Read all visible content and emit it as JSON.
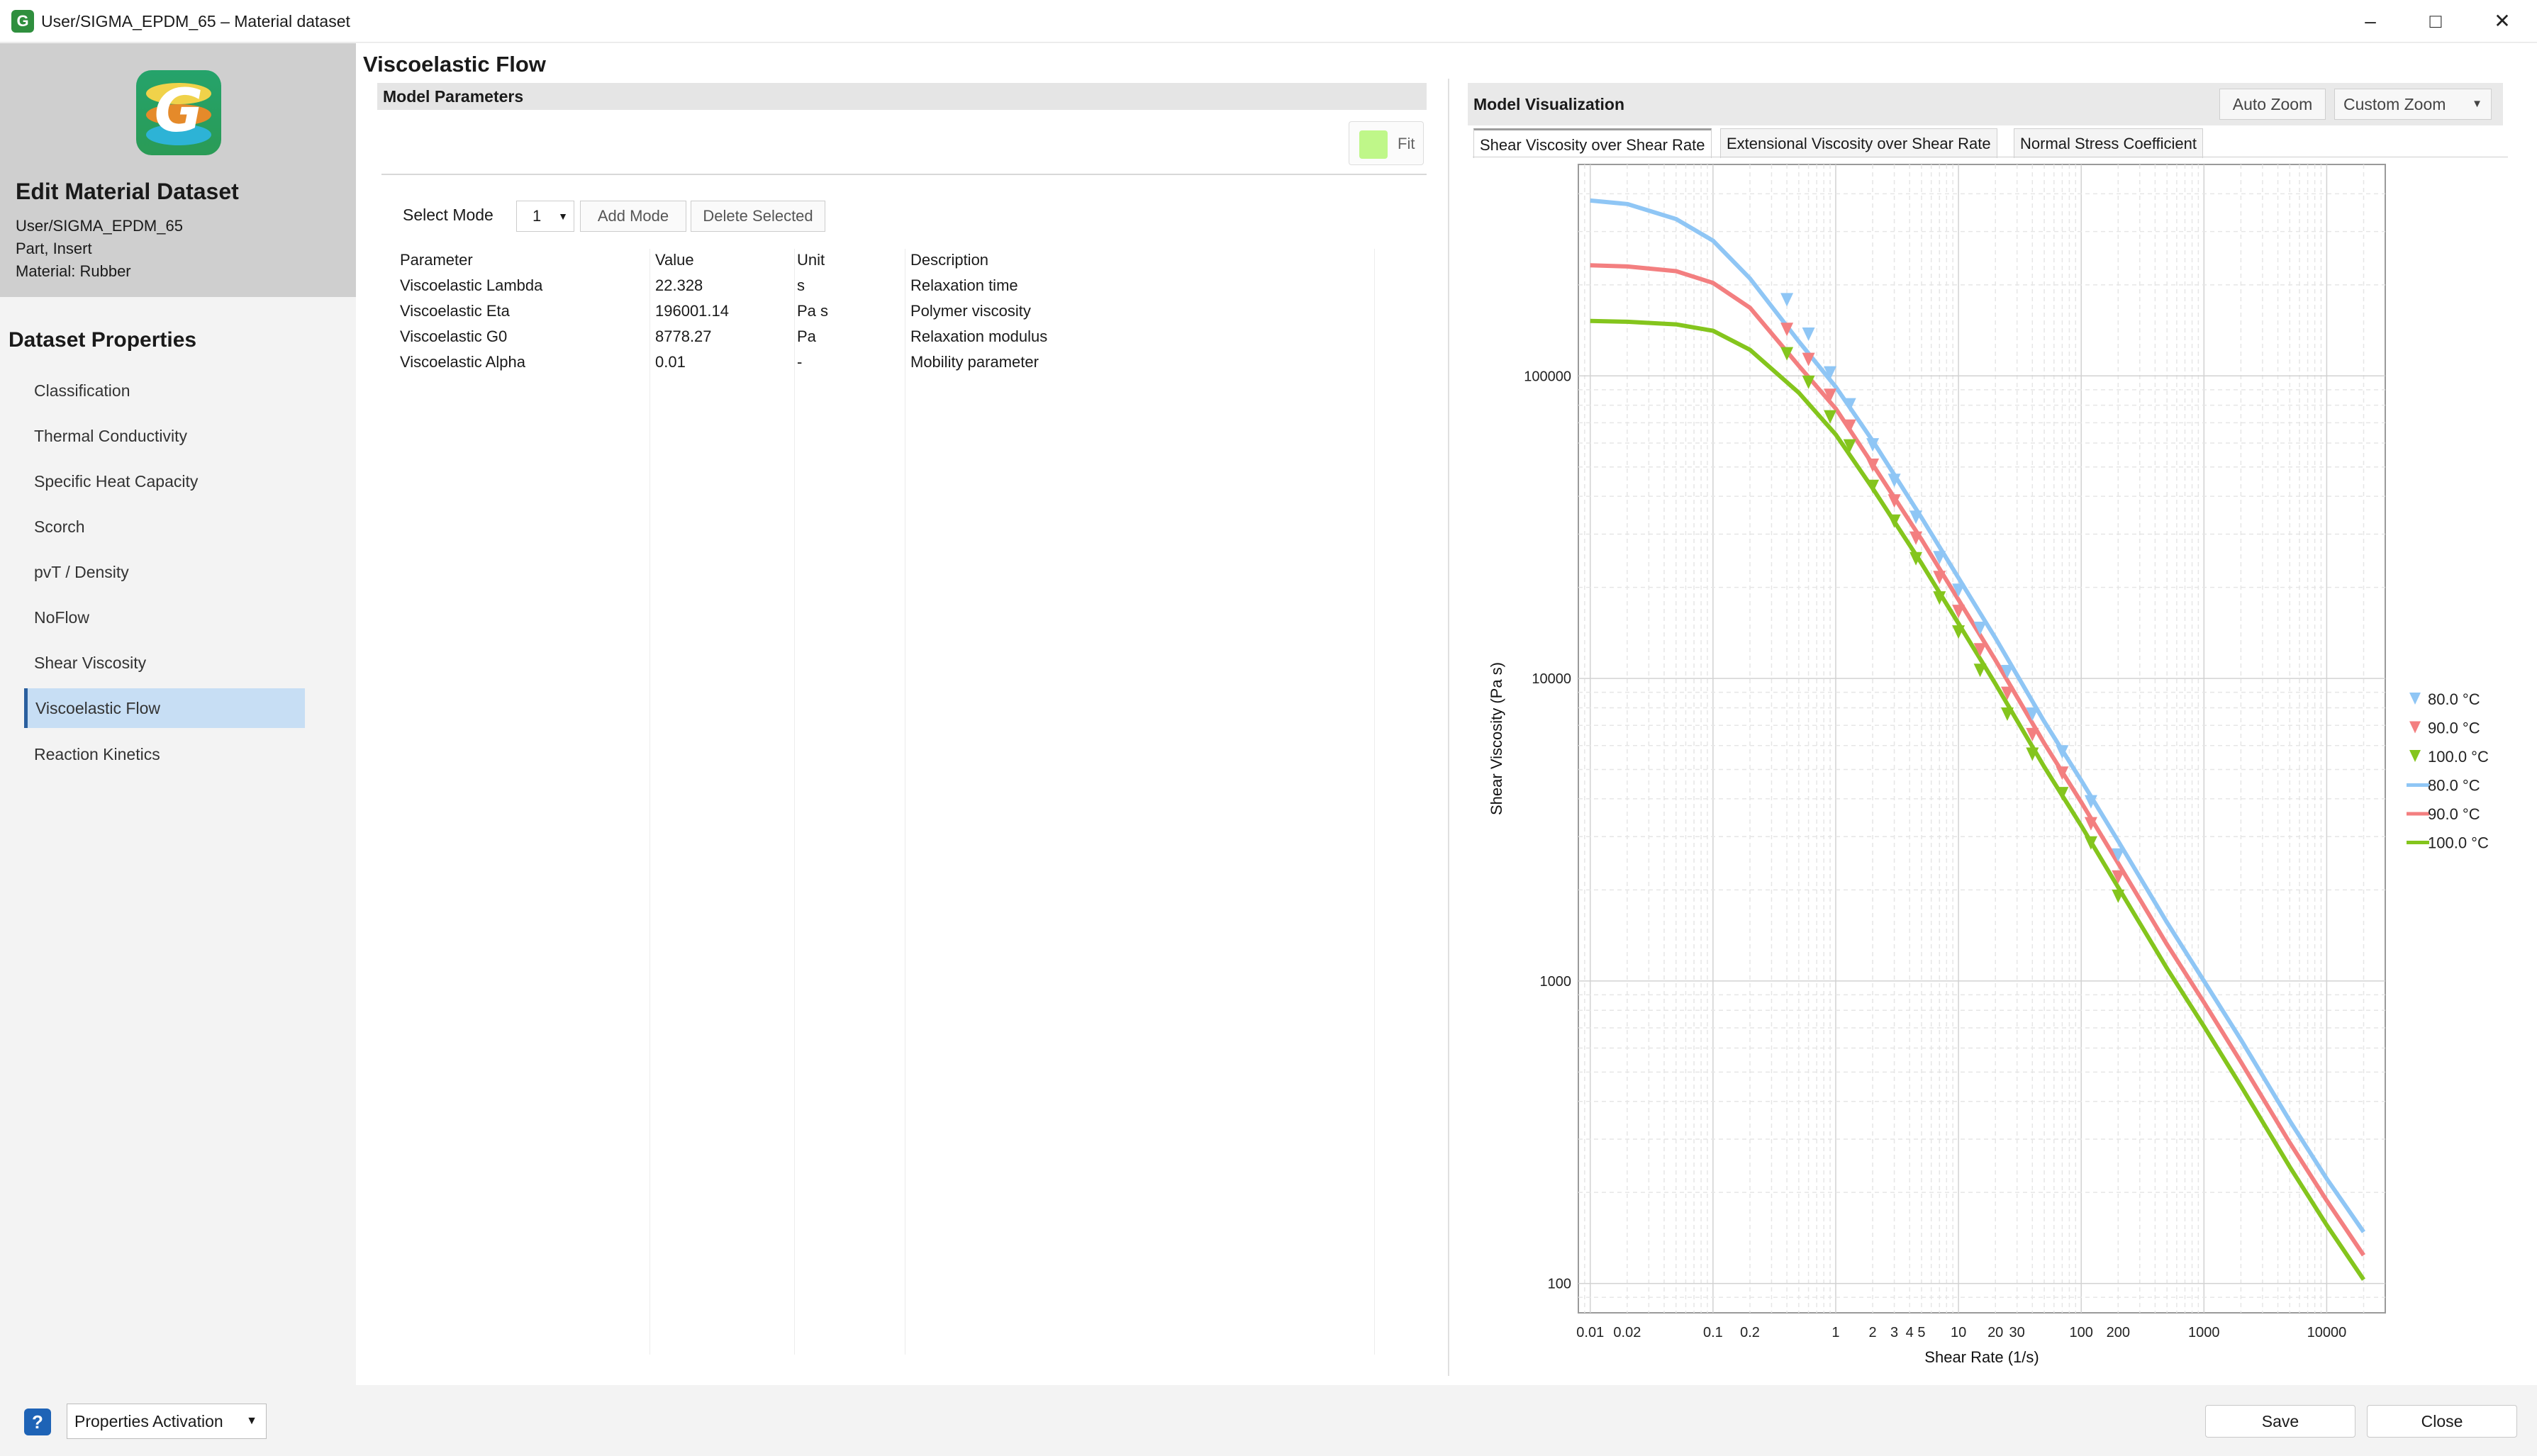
{
  "window": {
    "title": "User/SIGMA_EPDM_65  –  Material dataset",
    "minimize": "–",
    "maximize": "□",
    "close": "✕"
  },
  "sidebar": {
    "heading": "Edit Material Dataset",
    "dataset_path": "User/SIGMA_EPDM_65",
    "part": "Part, Insert",
    "material": "Material: Rubber",
    "section_title": "Dataset Properties",
    "items": [
      {
        "label": "Classification"
      },
      {
        "label": "Thermal Conductivity"
      },
      {
        "label": "Specific Heat Capacity"
      },
      {
        "label": "Scorch"
      },
      {
        "label": "pvT / Density"
      },
      {
        "label": "NoFlow"
      },
      {
        "label": "Shear Viscosity"
      },
      {
        "label": "Viscoelastic Flow",
        "active": true
      },
      {
        "label": "Reaction Kinetics"
      }
    ]
  },
  "main": {
    "title": "Viscoelastic Flow",
    "model_parameters": {
      "header": "Model Parameters",
      "fit_label": "Fit",
      "fit_color": "#bff789",
      "select_mode_label": "Select Mode",
      "mode_value": "1",
      "add_mode": "Add Mode",
      "delete_selected": "Delete Selected",
      "columns": [
        "Parameter",
        "Value",
        "Unit",
        "Description"
      ],
      "rows": [
        [
          "Viscoelastic Lambda",
          "22.328",
          "s",
          "Relaxation time"
        ],
        [
          "Viscoelastic Eta",
          "196001.14",
          "Pa s",
          "Polymer viscosity"
        ],
        [
          "Viscoelastic G0",
          "8778.27",
          "Pa",
          "Relaxation modulus"
        ],
        [
          "Viscoelastic Alpha",
          "0.01",
          "-",
          "Mobility parameter"
        ]
      ]
    }
  },
  "visualization": {
    "header": "Model Visualization",
    "auto_zoom": "Auto Zoom",
    "custom_zoom": "Custom Zoom",
    "tabs": [
      {
        "label": "Shear Viscosity over Shear Rate",
        "active": true
      },
      {
        "label": "Extensional Viscosity over Shear Rate"
      },
      {
        "label": "Normal Stress Coefficient"
      }
    ]
  },
  "chart_data": {
    "type": "line",
    "xlabel": "Shear Rate (1/s)",
    "ylabel": "Shear Viscosity (Pa s)",
    "xscale": "log",
    "yscale": "log",
    "xlim": [
      0.008,
      30000
    ],
    "ylim": [
      80,
      500000
    ],
    "grid": true,
    "legend_position": "right",
    "x_tick_labels": [
      {
        "v": 0.01,
        "t": "0.01"
      },
      {
        "v": 0.02,
        "t": "0.02"
      },
      {
        "v": 0.1,
        "t": "0.1"
      },
      {
        "v": 0.2,
        "t": "0.2"
      },
      {
        "v": 1,
        "t": "1"
      },
      {
        "v": 2,
        "t": "2"
      },
      {
        "v": 3,
        "t": "3"
      },
      {
        "v": 4,
        "t": "4"
      },
      {
        "v": 5,
        "t": "5"
      },
      {
        "v": 10,
        "t": "10"
      },
      {
        "v": 20,
        "t": "20"
      },
      {
        "v": 30,
        "t": "30"
      },
      {
        "v": 100,
        "t": "100"
      },
      {
        "v": 200,
        "t": "200"
      },
      {
        "v": 1000,
        "t": "1000"
      },
      {
        "v": 10000,
        "t": "10000"
      }
    ],
    "y_tick_labels": [
      {
        "v": 100,
        "t": "100"
      },
      {
        "v": 1000,
        "t": "1000"
      },
      {
        "v": 10000,
        "t": "10000"
      },
      {
        "v": 100000,
        "t": "100000"
      }
    ],
    "series": [
      {
        "name": "80.0 °C",
        "kind": "line",
        "color": "#8fc6f5",
        "x": [
          0.01,
          0.02,
          0.05,
          0.1,
          0.2,
          0.5,
          1,
          2,
          5,
          10,
          20,
          50,
          100,
          200,
          500,
          1000,
          2000,
          5000,
          10000,
          20000
        ],
        "y": [
          380000,
          370000,
          330000,
          280000,
          210000,
          130000,
          92000,
          61000,
          34000,
          21500,
          13600,
          7200,
          4600,
          2900,
          1560,
          1000,
          640,
          345,
          222,
          148
        ]
      },
      {
        "name": "90.0 °C",
        "kind": "line",
        "color": "#f37f80",
        "x": [
          0.01,
          0.02,
          0.05,
          0.1,
          0.2,
          0.5,
          1,
          2,
          5,
          10,
          20,
          50,
          100,
          200,
          500,
          1000,
          2000,
          5000,
          10000,
          20000
        ],
        "y": [
          232000,
          230000,
          222000,
          203000,
          168000,
          108000,
          78000,
          51000,
          28800,
          18200,
          11500,
          6100,
          3900,
          2450,
          1320,
          850,
          540,
          292,
          188,
          124
        ]
      },
      {
        "name": "100.0 °C",
        "kind": "line",
        "color": "#84c51d",
        "x": [
          0.01,
          0.02,
          0.05,
          0.1,
          0.2,
          0.5,
          1,
          2,
          5,
          10,
          20,
          50,
          100,
          200,
          500,
          1000,
          2000,
          5000,
          10000,
          20000
        ],
        "y": [
          152000,
          151000,
          148000,
          141000,
          122000,
          88000,
          64000,
          42500,
          24000,
          15200,
          9600,
          5100,
          3260,
          2040,
          1100,
          708,
          450,
          243,
          156,
          103
        ]
      },
      {
        "name": "80.0 °C",
        "kind": "marker",
        "color": "#8fc6f5",
        "x": [
          0.4,
          0.6,
          0.9,
          1.3,
          2,
          3,
          4.5,
          7,
          10,
          15,
          25,
          40,
          70,
          120,
          200
        ],
        "y": [
          178000,
          137000,
          102000,
          80000,
          59000,
          45000,
          34000,
          25000,
          19500,
          14600,
          10500,
          7600,
          5700,
          3900,
          2600
        ]
      },
      {
        "name": "90.0 °C",
        "kind": "marker",
        "color": "#f37f80",
        "x": [
          0.4,
          0.6,
          0.9,
          1.3,
          2,
          3,
          4.5,
          7,
          10,
          15,
          25,
          40,
          70,
          120,
          200
        ],
        "y": [
          142000,
          113000,
          86000,
          68000,
          50500,
          38500,
          29000,
          21500,
          16600,
          12400,
          8900,
          6500,
          4850,
          3300,
          2200
        ]
      },
      {
        "name": "100.0 °C",
        "kind": "marker",
        "color": "#84c51d",
        "x": [
          0.4,
          0.6,
          0.9,
          1.3,
          2,
          3,
          4.5,
          7,
          10,
          15,
          25,
          40,
          70,
          120,
          200
        ],
        "y": [
          118000,
          95000,
          73000,
          58500,
          43000,
          33000,
          24800,
          18400,
          14200,
          10600,
          7600,
          5600,
          4150,
          2850,
          1900
        ]
      }
    ],
    "legend": [
      {
        "label": "80.0 °C",
        "kind": "marker",
        "color": "#8fc6f5"
      },
      {
        "label": "90.0 °C",
        "kind": "marker",
        "color": "#f37f80"
      },
      {
        "label": "100.0 °C",
        "kind": "marker",
        "color": "#84c51d"
      },
      {
        "label": "80.0 °C",
        "kind": "line",
        "color": "#8fc6f5"
      },
      {
        "label": "90.0 °C",
        "kind": "line",
        "color": "#f37f80"
      },
      {
        "label": "100.0 °C",
        "kind": "line",
        "color": "#84c51d"
      }
    ]
  },
  "footer": {
    "help": "?",
    "properties_activation": "Properties Activation",
    "save": "Save",
    "close": "Close"
  }
}
